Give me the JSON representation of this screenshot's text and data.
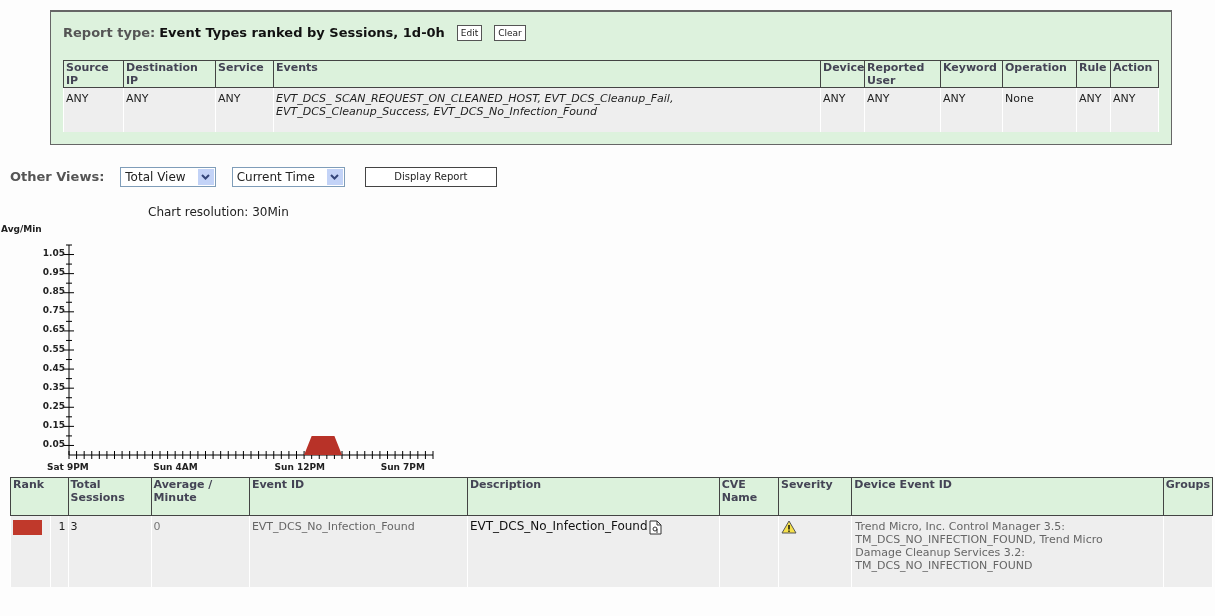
{
  "report": {
    "label": "Report type:",
    "title": "Event Types ranked by Sessions, 1d-0h",
    "buttons": [
      "Edit",
      "Clear"
    ],
    "columns": [
      "Source IP",
      "Destination IP",
      "Service",
      "Events",
      "Device",
      "Reported User",
      "Keyword",
      "Operation",
      "Rule",
      "Action"
    ],
    "row": [
      "ANY",
      "ANY",
      "ANY",
      "EVT_DCS_ SCAN_REQUEST_ON_CLEANED_HOST, EVT_DCS_Cleanup_Fail, EVT_DCS_Cleanup_Success, EVT_DCS_No_Infection_Found",
      "ANY",
      "ANY",
      "ANY",
      "None",
      "ANY",
      "ANY"
    ]
  },
  "views": {
    "label": "Other Views:",
    "view_select": "Total View",
    "time_select": "Current Time",
    "button": "Display Report"
  },
  "chart": {
    "resolution": "Chart resolution: 30Min",
    "chart_data": {
      "type": "area",
      "ylabel": "Avg/Min",
      "categories": [
        "Sat 9PM",
        null,
        null,
        null,
        null,
        null,
        null,
        null,
        null,
        null,
        null,
        null,
        null,
        null,
        "Sun 4AM",
        null,
        null,
        null,
        null,
        null,
        null,
        null,
        null,
        null,
        null,
        null,
        null,
        null,
        null,
        null,
        "Sun 12PM",
        null,
        null,
        null,
        null,
        null,
        null,
        null,
        null,
        null,
        null,
        null,
        null,
        null,
        "Sun 7PM",
        null,
        null,
        null,
        null
      ],
      "series": [
        {
          "color": "#b83228",
          "values": [
            0,
            0,
            0,
            0,
            0,
            0,
            0,
            0,
            0,
            0,
            0,
            0,
            0,
            0,
            0,
            0,
            0,
            0,
            0,
            0,
            0,
            0,
            0,
            0,
            0,
            0,
            0,
            0,
            0,
            0,
            0,
            0,
            0.1,
            0.1,
            0.1,
            0.1,
            0,
            0,
            0,
            0,
            0,
            0,
            0,
            0,
            0,
            0,
            0,
            0,
            0
          ]
        }
      ],
      "ylim": [
        0,
        1.1
      ],
      "yticks": [
        0.05,
        0.15,
        0.25,
        0.35,
        0.45,
        0.55,
        0.65,
        0.75,
        0.85,
        0.95,
        1.05
      ]
    }
  },
  "table": {
    "columns": [
      "Rank",
      "Total Sessions",
      "Average / Minute",
      "Event ID",
      "Description",
      "CVE Name",
      "Severity",
      "Device Event ID",
      "Groups"
    ],
    "rows": [
      {
        "color": "#c0392b",
        "rank": "1",
        "total": "3",
        "average": "0",
        "event_id": "EVT_DCS_No_Infection_Found",
        "description": "EVT_DCS_No_Infection_Found",
        "warning": true,
        "device_event_id": "Trend Micro, Inc. Control Manager 3.5: TM_DCS_NO_INFECTION_FOUND, Trend Micro Damage Cleanup Services 3.2: TM_DCS_NO_INFECTION_FOUND"
      }
    ]
  }
}
